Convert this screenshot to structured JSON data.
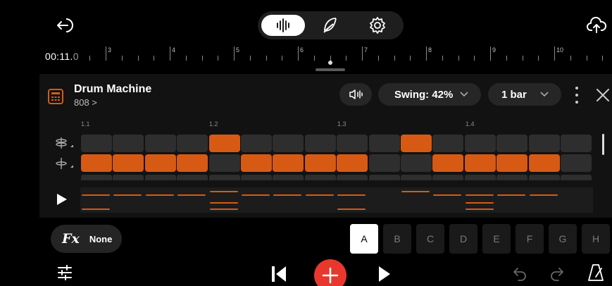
{
  "header": {
    "modes": [
      {
        "icon": "waveform-icon",
        "active": true
      },
      {
        "icon": "feather-icon",
        "active": false
      },
      {
        "icon": "gear-icon",
        "active": false
      }
    ]
  },
  "timeline": {
    "time_main": "00:11.",
    "time_ms": "0",
    "bar_numbers": [
      "3",
      "4",
      "5",
      "6",
      "7",
      "8",
      "9",
      "10"
    ]
  },
  "instrument": {
    "title": "Drum Machine",
    "kit": "808 >"
  },
  "controls": {
    "swing_label": "Swing: 42%",
    "length_label": "1 bar"
  },
  "beats": [
    "1.1",
    "1.2",
    "1.3",
    "1.4"
  ],
  "sequencer": {
    "rows": [
      {
        "icon": "hihat-icon",
        "steps": [
          0,
          0,
          0,
          0,
          1,
          0,
          0,
          0,
          0,
          0,
          1,
          0,
          0,
          0,
          0,
          0
        ]
      },
      {
        "icon": "snare-icon",
        "steps": [
          1,
          1,
          1,
          1,
          0,
          1,
          1,
          1,
          1,
          0,
          0,
          1,
          1,
          1,
          1,
          0
        ]
      }
    ]
  },
  "fx": {
    "glyph": "Fx",
    "value": "None"
  },
  "patterns": {
    "items": [
      "A",
      "B",
      "C",
      "D",
      "E",
      "F",
      "G",
      "H"
    ],
    "active": "A"
  },
  "colors": {
    "accent": "#d65a14",
    "record": "#e8382e",
    "panel": "#121212"
  }
}
